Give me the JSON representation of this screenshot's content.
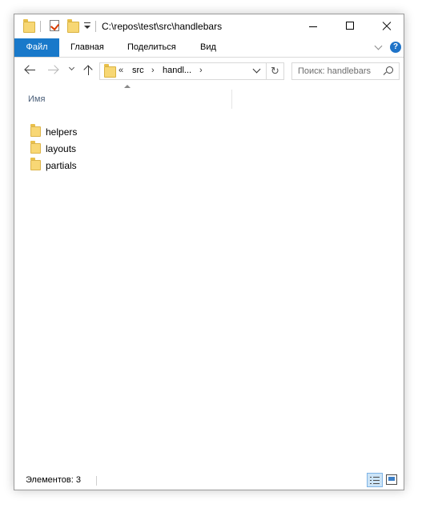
{
  "window": {
    "title": "C:\\repos\\test\\src\\handlebars",
    "controls": [
      "minimize-icon",
      "maximize-icon",
      "close-icon"
    ]
  },
  "quick_access": {
    "icons": [
      "folder-icon",
      "properties-icon",
      "new-folder-icon",
      "customize-dropdown-icon"
    ]
  },
  "ribbon": {
    "file_tab": "Файл",
    "tabs": [
      "Главная",
      "Поделиться",
      "Вид"
    ],
    "help_label": "?",
    "accent_color": "#1979ca"
  },
  "navigation": {
    "breadcrumb": {
      "overflow": "«",
      "segments": [
        "src",
        "handl..."
      ],
      "separator": "›"
    },
    "refresh_glyph": "↻",
    "search": {
      "placeholder": "Поиск: handlebars"
    }
  },
  "list": {
    "column_header": "Имя",
    "items": [
      {
        "name": "helpers",
        "type": "folder"
      },
      {
        "name": "layouts",
        "type": "folder"
      },
      {
        "name": "partials",
        "type": "folder"
      }
    ]
  },
  "status": {
    "item_count": "Элементов: 3",
    "views": [
      "details-view-icon",
      "large-icons-view-icon"
    ]
  }
}
